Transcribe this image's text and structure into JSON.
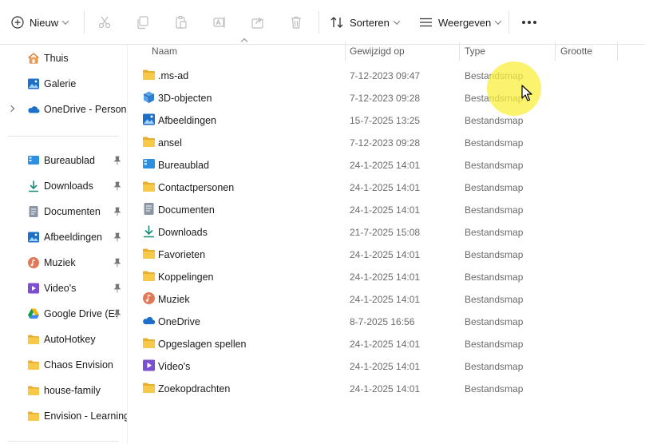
{
  "toolbar": {
    "new_label": "Nieuw",
    "sort_label": "Sorteren",
    "view_label": "Weergeven",
    "icons": [
      "plus-circle-icon",
      "cut-icon",
      "copy-icon",
      "paste-icon",
      "rename-icon",
      "share-icon",
      "delete-icon",
      "sort-icon",
      "view-icon",
      "more-icon"
    ]
  },
  "nav": {
    "top_items": [
      {
        "label": "Thuis",
        "icon": "home-icon"
      },
      {
        "label": "Galerie",
        "icon": "gallery-icon"
      },
      {
        "label": "OneDrive - Persona",
        "icon": "onedrive-icon"
      }
    ],
    "pinned_items": [
      {
        "label": "Bureaublad",
        "icon": "desktop-icon"
      },
      {
        "label": "Downloads",
        "icon": "download-icon"
      },
      {
        "label": "Documenten",
        "icon": "documents-icon"
      },
      {
        "label": "Afbeeldingen",
        "icon": "pictures-icon"
      },
      {
        "label": "Muziek",
        "icon": "music-icon"
      },
      {
        "label": "Video's",
        "icon": "video-icon"
      },
      {
        "label": "Google Drive (E:",
        "icon": "google-drive-icon"
      },
      {
        "label": "AutoHotkey",
        "icon": "folder-icon"
      },
      {
        "label": "Chaos Envision",
        "icon": "folder-icon"
      },
      {
        "label": "house-family",
        "icon": "folder-icon"
      },
      {
        "label": "Envision - Learning",
        "icon": "folder-icon"
      }
    ]
  },
  "columns": {
    "name": "Naam",
    "modified": "Gewijzigd op",
    "type": "Type",
    "size": "Grootte"
  },
  "files": [
    {
      "name": ".ms-ad",
      "date": "7-12-2023 09:47",
      "type": "Bestandsmap",
      "icon": "folder-icon"
    },
    {
      "name": "3D-objecten",
      "date": "7-12-2023 09:28",
      "type": "Bestandsmap",
      "icon": "3d-objects-icon"
    },
    {
      "name": "Afbeeldingen",
      "date": "15-7-2025 13:25",
      "type": "Bestandsmap",
      "icon": "pictures-icon"
    },
    {
      "name": "ansel",
      "date": "7-12-2023 09:28",
      "type": "Bestandsmap",
      "icon": "folder-icon"
    },
    {
      "name": "Bureaublad",
      "date": "24-1-2025 14:01",
      "type": "Bestandsmap",
      "icon": "desktop-icon"
    },
    {
      "name": "Contactpersonen",
      "date": "24-1-2025 14:01",
      "type": "Bestandsmap",
      "icon": "folder-icon"
    },
    {
      "name": "Documenten",
      "date": "24-1-2025 14:01",
      "type": "Bestandsmap",
      "icon": "documents-icon"
    },
    {
      "name": "Downloads",
      "date": "21-7-2025 15:08",
      "type": "Bestandsmap",
      "icon": "download-icon"
    },
    {
      "name": "Favorieten",
      "date": "24-1-2025 14:01",
      "type": "Bestandsmap",
      "icon": "folder-icon"
    },
    {
      "name": "Koppelingen",
      "date": "24-1-2025 14:01",
      "type": "Bestandsmap",
      "icon": "folder-icon"
    },
    {
      "name": "Muziek",
      "date": "24-1-2025 14:01",
      "type": "Bestandsmap",
      "icon": "music-icon"
    },
    {
      "name": "OneDrive",
      "date": "8-7-2025 16:56",
      "type": "Bestandsmap",
      "icon": "onedrive-icon"
    },
    {
      "name": "Opgeslagen spellen",
      "date": "24-1-2025 14:01",
      "type": "Bestandsmap",
      "icon": "folder-icon"
    },
    {
      "name": "Video's",
      "date": "24-1-2025 14:01",
      "type": "Bestandsmap",
      "icon": "video-icon"
    },
    {
      "name": "Zoekopdrachten",
      "date": "24-1-2025 14:01",
      "type": "Bestandsmap",
      "icon": "folder-icon"
    }
  ],
  "colors": {
    "folder": "#F4C542",
    "accent": "#1a73c9",
    "cursor_highlight": "#FAEE3C"
  }
}
